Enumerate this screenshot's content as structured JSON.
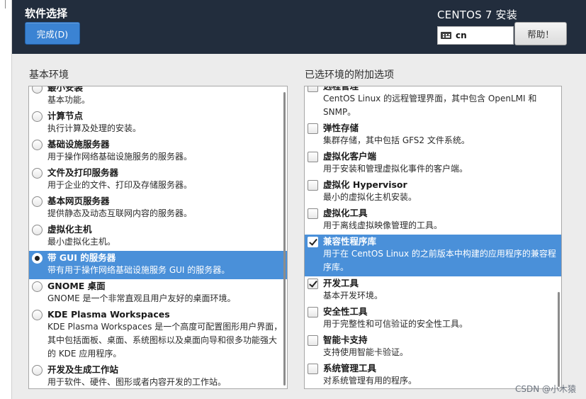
{
  "header": {
    "title": "软件选择",
    "done_label": "完成(D)",
    "product": "CENTOS 7 安装",
    "keyboard_layout": "cn",
    "help_label": "帮助！"
  },
  "base_env": {
    "title": "基本环境",
    "items": [
      {
        "name": "最小安装",
        "desc": "基本功能。",
        "checked": false
      },
      {
        "name": "计算节点",
        "desc": "执行计算及处理的安装。",
        "checked": false
      },
      {
        "name": "基础设施服务器",
        "desc": "用于操作网络基础设施服务的服务器。",
        "checked": false
      },
      {
        "name": "文件及打印服务器",
        "desc": "用于企业的文件、打印及存储服务器。",
        "checked": false
      },
      {
        "name": "基本网页服务器",
        "desc": "提供静态及动态互联网内容的服务器。",
        "checked": false
      },
      {
        "name": "虚拟化主机",
        "desc": "最小虚拟化主机。",
        "checked": false
      },
      {
        "name": "带 GUI 的服务器",
        "desc": "带有用于操作网络基础设施服务 GUI 的服务器。",
        "checked": true
      },
      {
        "name": "GNOME 桌面",
        "desc": "GNOME 是一个非常直观且用户友好的桌面环境。",
        "checked": false
      },
      {
        "name": "KDE Plasma Workspaces",
        "desc": "KDE Plasma Workspaces 是一个高度可配置图形用户界面，其中包括面板、桌面、系统图标以及桌面向导和很多功能强大的 KDE 应用程序。",
        "checked": false
      },
      {
        "name": "开发及生成工作站",
        "desc": "用于软件、硬件、图形或者内容开发的工作站。",
        "checked": false
      }
    ]
  },
  "addons": {
    "title": "已选环境的附加选项",
    "items": [
      {
        "name": "远程管理",
        "desc": "CentOS Linux 的远程管理界面，其中包含 OpenLMI 和 SNMP。",
        "checked": false
      },
      {
        "name": "弹性存储",
        "desc": "集群存储，其中包括 GFS2 文件系统。",
        "checked": false
      },
      {
        "name": "虚拟化客户端",
        "desc": "用于安装和管理虚拟化事件的客户端。",
        "checked": false
      },
      {
        "name": "虚拟化 Hypervisor",
        "desc": "最小的虚拟化主机安装。",
        "checked": false
      },
      {
        "name": "虚拟化工具",
        "desc": "用于离线虚拟映像管理的工具。",
        "checked": false
      },
      {
        "name": "兼容性程序库",
        "desc": "用于在 CentOS Linux 的之前版本中构建的应用程序的兼容程序库。",
        "checked": true
      },
      {
        "name": "开发工具",
        "desc": "基本开发环境。",
        "checked": true
      },
      {
        "name": "安全性工具",
        "desc": "用于完整性和可信验证的安全性工具。",
        "checked": false
      },
      {
        "name": "智能卡支持",
        "desc": "支持使用智能卡验证。",
        "checked": false
      },
      {
        "name": "系统管理工具",
        "desc": "对系统管理有用的程序。",
        "checked": false
      }
    ]
  },
  "watermark": "CSDN @小木猿",
  "colors": {
    "header_bg": "#222d3d",
    "accent": "#3b83d3",
    "selection": "#4a90d9"
  }
}
